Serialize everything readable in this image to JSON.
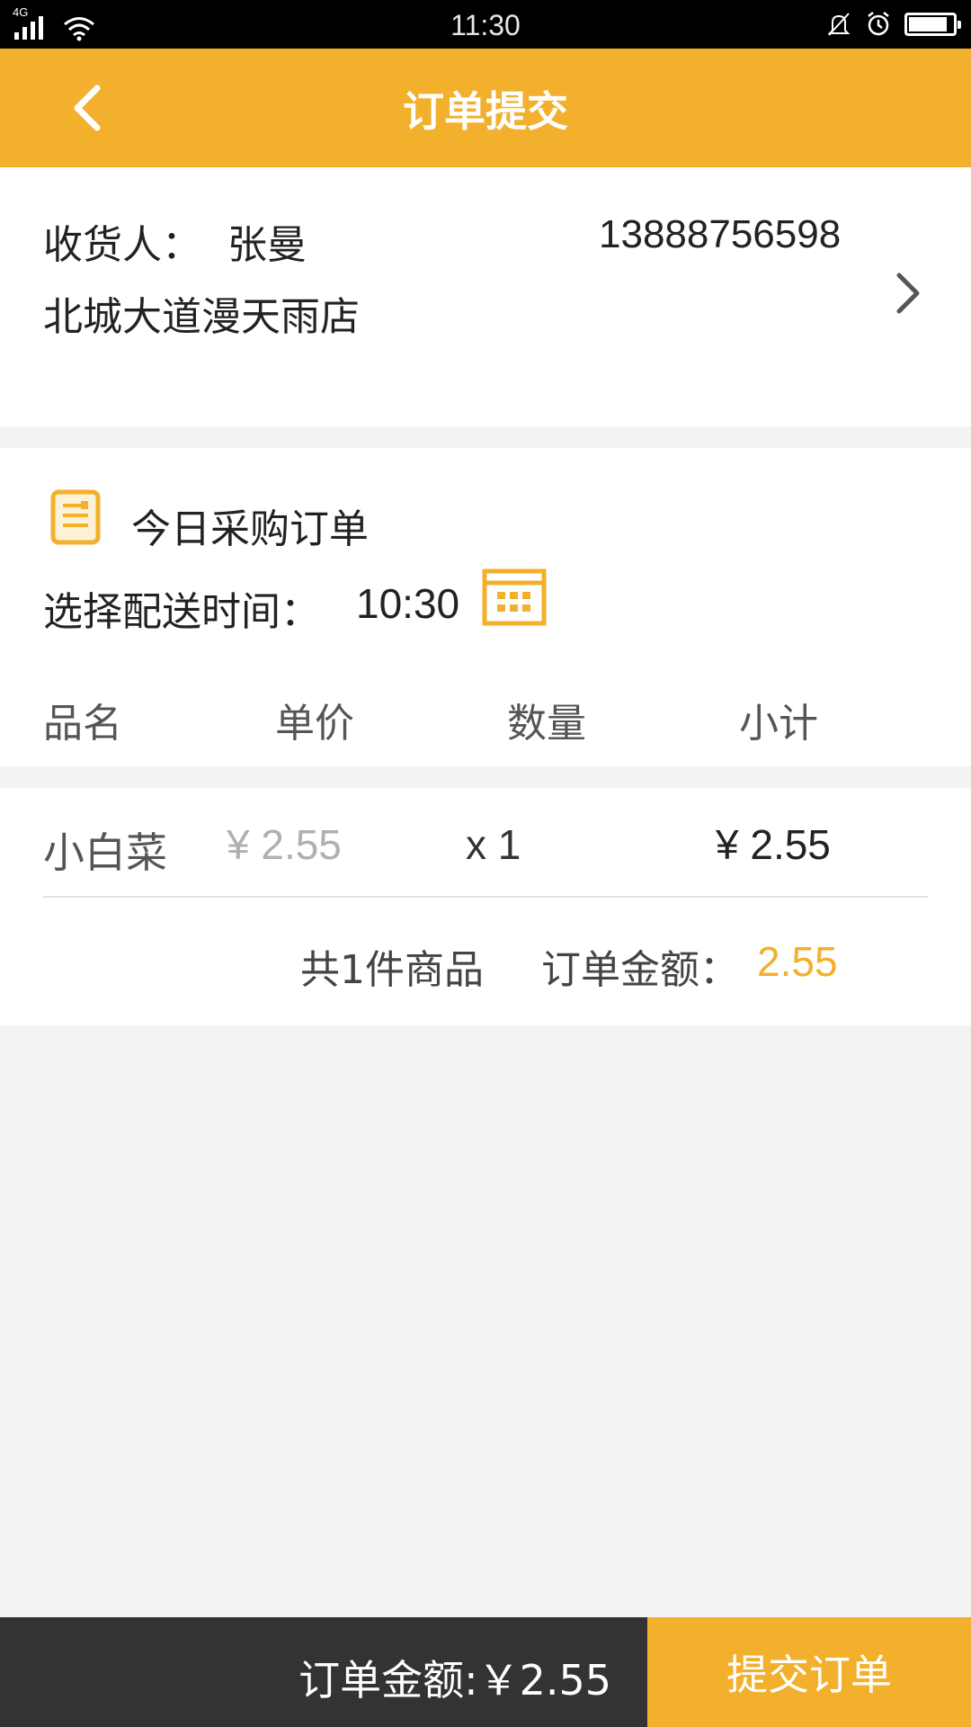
{
  "status_bar": {
    "network": "4G",
    "time": "11:30",
    "icons": [
      "signal-icon",
      "wifi-icon",
      "bell-muted-icon",
      "alarm-icon",
      "battery-icon"
    ]
  },
  "header": {
    "title": "订单提交",
    "back_icon": "chevron-left-icon"
  },
  "address": {
    "recipient_label": "收货人：",
    "recipient_name": "张曼",
    "phone": "13888756598",
    "location": "北城大道漫天雨店",
    "arrow_icon": "chevron-right-icon"
  },
  "order": {
    "title": "今日采购订单",
    "icon": "document-icon",
    "delivery_label": "选择配送时间：",
    "delivery_time": "10:30",
    "calendar_icon": "calendar-icon",
    "columns": [
      "品名",
      "单价",
      "数量",
      "小计"
    ]
  },
  "items": [
    {
      "name": "小白菜",
      "unit_price": "¥ 2.55",
      "quantity": "x 1",
      "subtotal": "¥ 2.55"
    }
  ],
  "summary": {
    "count_text": "共1件商品",
    "amount_label": "订单金额：",
    "amount_value": "2.55"
  },
  "bottom_bar": {
    "total_text": "订单金额:￥2.55",
    "submit_label": "提交订单"
  },
  "colors": {
    "accent": "#f2b02c",
    "bottom_bar": "#333333",
    "background": "#f3f3f3"
  }
}
